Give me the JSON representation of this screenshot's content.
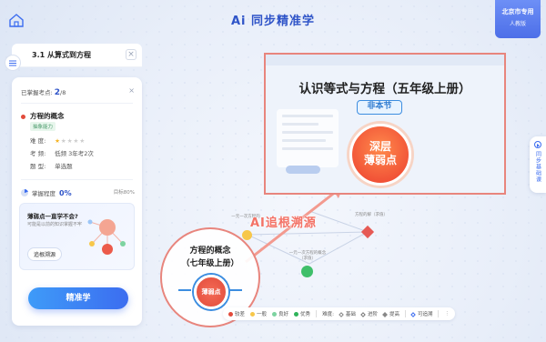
{
  "app": {
    "title": "Ai 同步精准学"
  },
  "region": {
    "line1": "北京市专用",
    "line2": "人教版"
  },
  "panel": {
    "header_title": "3.1 从算式到方程",
    "mastered_label": "已掌握考点:",
    "mastered_count": "2",
    "mastered_total": "/8",
    "knowledge_point": "方程的概念",
    "tag": "抽象能力",
    "difficulty_label": "难 度:",
    "difficulty_stars": 1,
    "exam_label": "考 频:",
    "exam_value": "低频 3年考2次",
    "type_label": "题 型:",
    "type_value": "单选题",
    "progress_label": "掌握程度",
    "progress_value": "0%",
    "target": "目标80%",
    "weak_title": "薄弱点一直学不会?",
    "weak_sub": "可能是以前的知识掌握不牢",
    "trace_button": "追根溯源",
    "cta_button": "精准学"
  },
  "side_tab": {
    "label": "同步基础课"
  },
  "preview": {
    "title": "认识等式与方程（五年级上册）",
    "badge": "非本节",
    "deep_line1": "深层",
    "deep_line2": "薄弱点"
  },
  "canvas": {
    "ai_label": "AI追根溯源",
    "node_a": "一元一次方程的",
    "node_b": "一元一次方程的概念（求值）",
    "node_c": "方程的解（求值）",
    "big_node_line1": "方程的概念",
    "big_node_line2": "（七年级上册）",
    "weak_dot": "薄弱点"
  },
  "legend": {
    "items": [
      {
        "label": "较差",
        "color": "#e24b3b"
      },
      {
        "label": "一般",
        "color": "#f7c74a"
      },
      {
        "label": "良好",
        "color": "#7dd3a0"
      },
      {
        "label": "优秀",
        "color": "#2fb35a"
      }
    ],
    "difficulty_label": "难度:",
    "levels": [
      "基础",
      "进阶",
      "提高"
    ],
    "traceable": "可追溯"
  }
}
